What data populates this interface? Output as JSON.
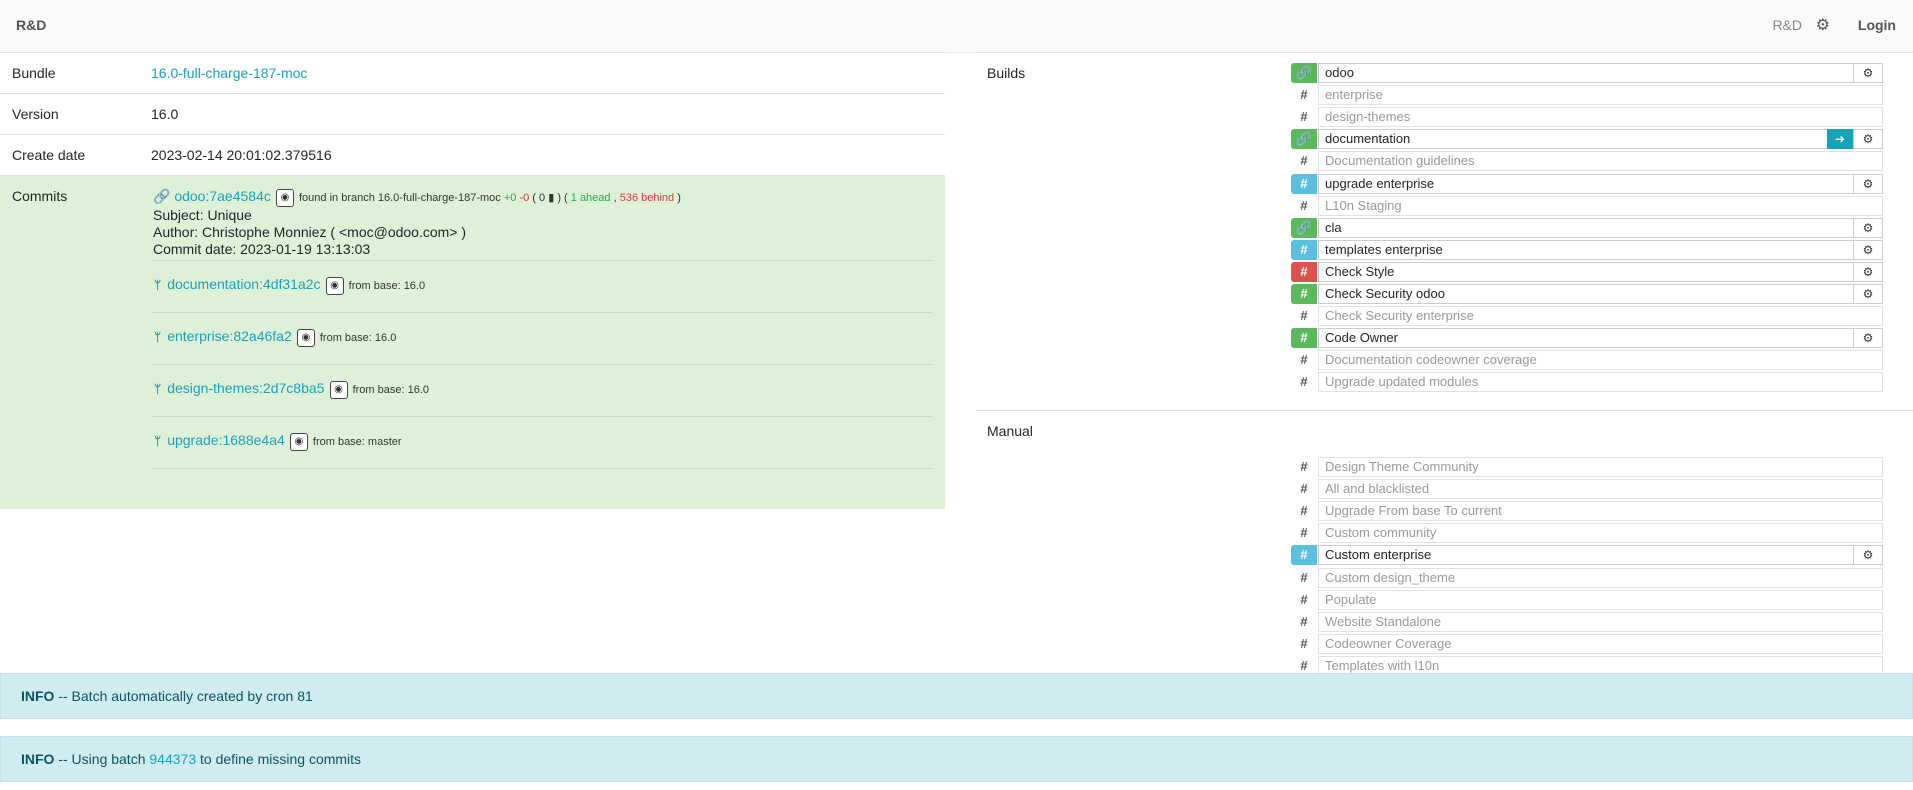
{
  "nav": {
    "brand": "R&D",
    "project": "R&D",
    "login": "Login"
  },
  "info": {
    "bundle_label": "Bundle",
    "bundle": "16.0-full-charge-187-moc",
    "version_label": "Version",
    "version": "16.0",
    "create_label": "Create date",
    "create_date": "2023-02-14 20:01:02.379516",
    "commits_label": "Commits"
  },
  "commit": {
    "ref": "odoo:7ae4584c",
    "found": "found in branch 16.0-full-charge-187-moc",
    "plus": "+0",
    "minus": "-0",
    "files": "( 0",
    "ahead": "1 ahead",
    "behind": "536 behind",
    "subject": "Subject: Unique",
    "author": "Author: Christophe Monniez ( <moc@odoo.com> )",
    "date": "Commit date: 2023-01-19 13:13:03"
  },
  "subcommits": [
    {
      "ref": "documentation:4df31a2c",
      "base": "from base: 16.0"
    },
    {
      "ref": "enterprise:82a46fa2",
      "base": "from base: 16.0"
    },
    {
      "ref": "design-themes:2d7c8ba5",
      "base": "from base: 16.0"
    },
    {
      "ref": "upgrade:1688e4a4",
      "base": "from base: master"
    }
  ],
  "builds_label": "Builds",
  "manual_label": "Manual",
  "builds": [
    {
      "name": "odoo",
      "badge": "green",
      "icon": "link",
      "active": true
    },
    {
      "name": "enterprise",
      "badge": "plain",
      "icon": "hash",
      "active": false
    },
    {
      "name": "design-themes",
      "badge": "plain",
      "icon": "hash",
      "active": false
    },
    {
      "name": "documentation",
      "badge": "green",
      "icon": "link",
      "active": true,
      "login": true
    },
    {
      "name": "Documentation guidelines",
      "badge": "plain",
      "icon": "hash",
      "active": false
    },
    {
      "name": "upgrade enterprise",
      "badge": "info",
      "icon": "hash",
      "active": true
    },
    {
      "name": "L10n Staging",
      "badge": "plain",
      "icon": "hash",
      "active": false
    },
    {
      "name": "cla",
      "badge": "green",
      "icon": "link",
      "active": true
    },
    {
      "name": "templates enterprise",
      "badge": "info",
      "icon": "hash",
      "active": true
    },
    {
      "name": "Check Style",
      "badge": "red",
      "icon": "hash",
      "active": true
    },
    {
      "name": "Check Security odoo",
      "badge": "green",
      "icon": "hash",
      "active": true
    },
    {
      "name": "Check Security enterprise",
      "badge": "plain",
      "icon": "hash",
      "active": false
    },
    {
      "name": "Code Owner",
      "badge": "green",
      "icon": "hash",
      "active": true
    },
    {
      "name": "Documentation codeowner coverage",
      "badge": "plain",
      "icon": "hash",
      "active": false
    },
    {
      "name": "Upgrade updated modules",
      "badge": "plain",
      "icon": "hash",
      "active": false
    }
  ],
  "manual": [
    {
      "name": "Design Theme Community",
      "badge": "plain",
      "active": false
    },
    {
      "name": "All and blacklisted",
      "badge": "plain",
      "active": false
    },
    {
      "name": "Upgrade From base To current",
      "badge": "plain",
      "active": false
    },
    {
      "name": "Custom community",
      "badge": "plain",
      "active": false
    },
    {
      "name": "Custom enterprise",
      "badge": "info",
      "active": true
    },
    {
      "name": "Custom design_theme",
      "badge": "plain",
      "active": false
    },
    {
      "name": "Populate",
      "badge": "plain",
      "active": false
    },
    {
      "name": "Website Standalone",
      "badge": "plain",
      "active": false
    },
    {
      "name": "Codeowner Coverage",
      "badge": "plain",
      "active": false
    },
    {
      "name": "Templates with l10n",
      "badge": "plain",
      "active": false
    }
  ],
  "alerts": [
    {
      "level": "INFO",
      "text": " -- Batch automatically created by cron 81"
    },
    {
      "level": "INFO",
      "pre": " -- Using batch ",
      "link": "944373",
      "post": " to define missing commits"
    }
  ]
}
